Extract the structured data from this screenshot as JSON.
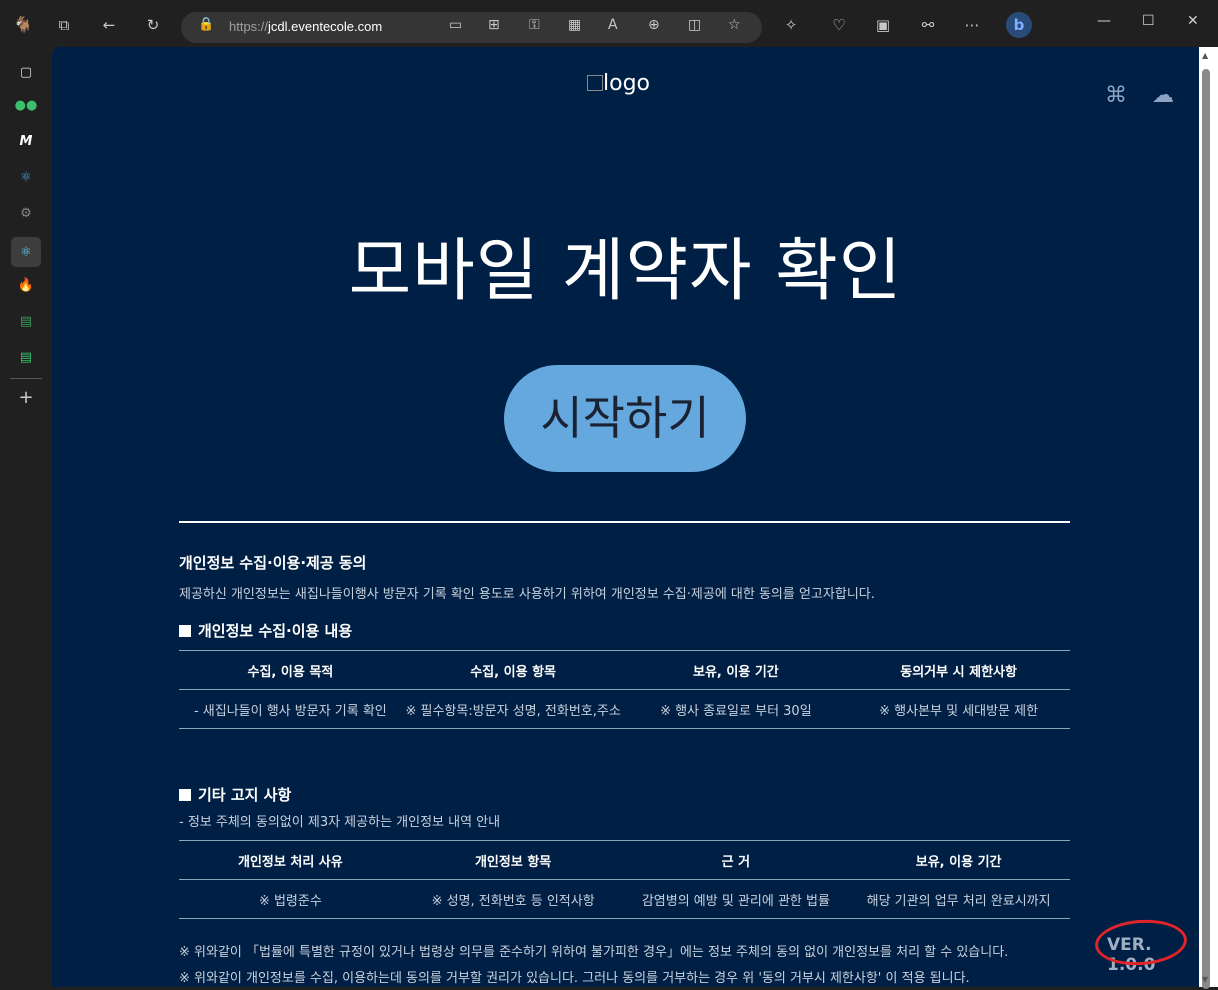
{
  "browser": {
    "url_scheme": "https://",
    "url_host": "jcdl.eventecole.com",
    "lock_icon": "lock-icon",
    "toolbar_icons": [
      "tabs-icon",
      "back-icon",
      "refresh-icon",
      "device-icon",
      "apps-icon",
      "key-icon",
      "grid-icon",
      "read-aloud-icon",
      "zoom-icon",
      "split-icon",
      "favorite-icon",
      "extensions-icon",
      "health-icon",
      "vx-icon",
      "share-icon",
      "more-icon",
      "bing-icon"
    ],
    "window_controls": [
      "minimize",
      "maximize",
      "close"
    ]
  },
  "sidebar": {
    "items": [
      "tab-actions-icon",
      "green-app-icon",
      "m-app-icon",
      "react-icon",
      "settings-icon",
      "react-active-icon",
      "fire-icon",
      "sheet-icon",
      "sheet-green-icon",
      "add-icon"
    ]
  },
  "page": {
    "logo_text": "logo",
    "title": "모바일 계약자 확인",
    "start_button": "시작하기",
    "consent": {
      "heading": "개인정보 수집·이용·제공 동의",
      "description": "제공하신 개인정보는 새집나들이행사 방문자 기록 확인 용도로 사용하기 위하여 개인정보 수집·제공에 대한 동의를 얻고자합니다.",
      "section1_title": "개인정보 수집·이용 내용",
      "table1": {
        "headers": [
          "수집, 이용 목적",
          "수집, 이용 항목",
          "보유, 이용 기간",
          "동의거부 시 제한사항"
        ],
        "rows": [
          [
            "- 새집나들이 행사 방문자 기록 확인",
            "※ 필수항목:방문자 성명, 전화번호,주소",
            "※ 행사 종료일로 부터 30일",
            "※ 행사본부 및 세대방문 제한"
          ]
        ]
      },
      "section2_title": "기타 고지 사항",
      "section2_sub": "- 정보 주체의 동의없이 제3자 제공하는 개인정보 내역 안내",
      "table2": {
        "headers": [
          "개인정보 처리 사유",
          "개인정보 항목",
          "근 거",
          "보유, 이용 기간"
        ],
        "rows": [
          [
            "※ 법령준수",
            "※ 성명, 전화번호 등 인적사항",
            "감염병의 예방 및 관리에 관한 법률",
            "해당 기관의 업무 처리 완료시까지"
          ]
        ]
      },
      "notes": [
        "※ 위와같이 「법률에 특별한 규정이 있거나 법령상 의무를 준수하기 위하여 불가피한 경우」에는 정보 주체의 동의 없이 개인정보를 처리 할 수 있습니다.",
        "※ 위와같이 개인정보를 수집, 이용하는데 동의를 거부할 권리가 있습니다. 그러나 동의를 거부하는 경우 위 '동의 거부시 제한사항' 이 적용 됩니다."
      ]
    },
    "version": "VER. 1.0.0"
  },
  "colors": {
    "page_bg": "#001f44",
    "button_bg": "#65a8de",
    "annotation": "#e0242a"
  }
}
